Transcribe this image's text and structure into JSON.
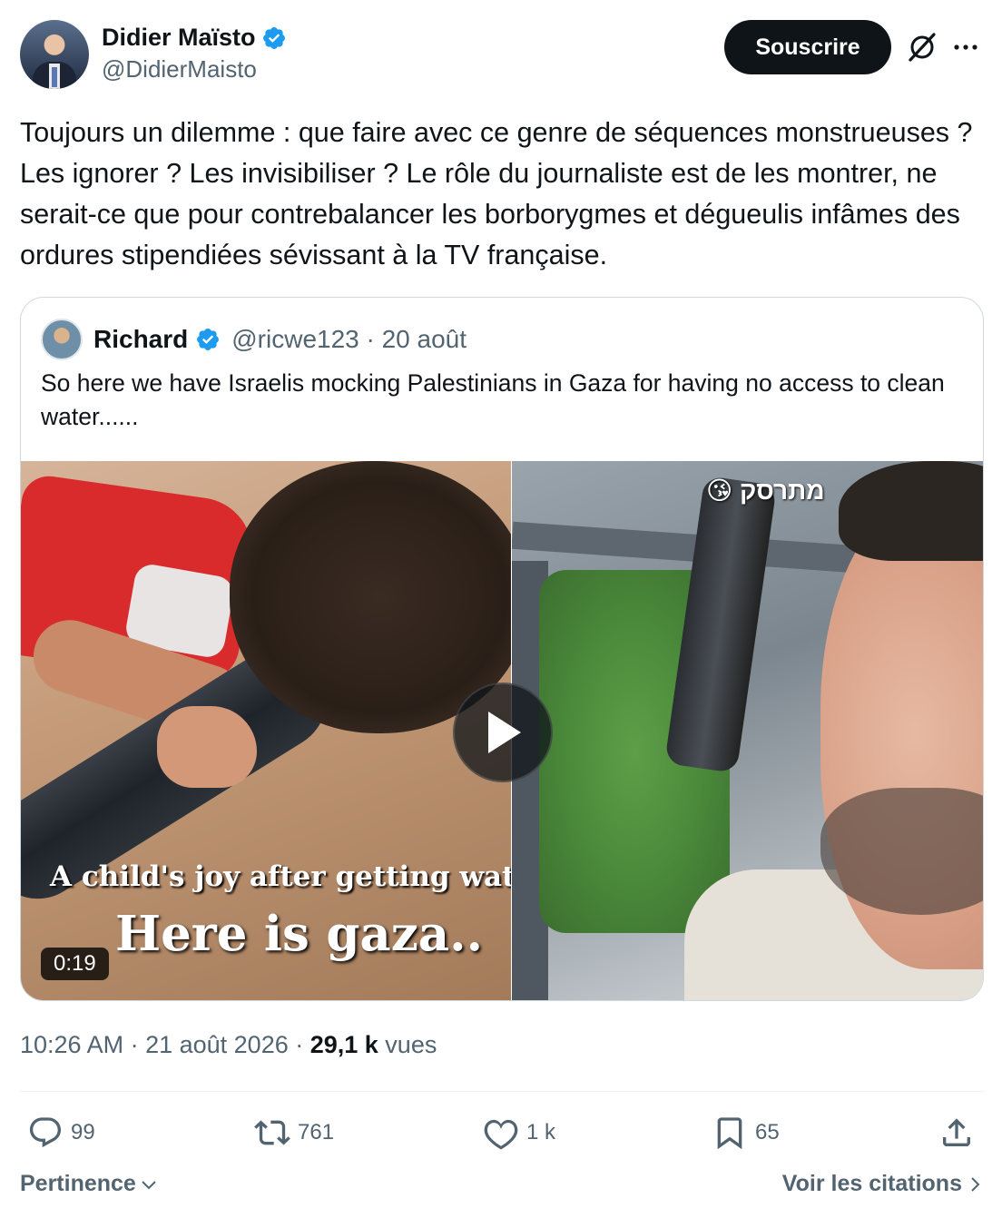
{
  "author": {
    "display_name": "Didier Maïsto",
    "handle": "@DidierMaisto",
    "verified": true
  },
  "header": {
    "subscribe_label": "Souscrire",
    "icons": [
      "grok-icon",
      "more-icon"
    ]
  },
  "tweet": {
    "text": "Toujours un dilemme : que faire avec ce genre de séquences monstrueuses ? Les ignorer ? Les invisibiliser ? Le rôle du journaliste est de les montrer, ne serait-ce que pour contrebalancer les borborygmes et dégueulis infâmes des ordures stipendiées sévissant à la TV française."
  },
  "quote": {
    "display_name": "Richard",
    "handle_date": "@ricwe123 · 20 août",
    "text": "So here we have Israelis mocking Palestinians in Gaza for having no access to clean water......",
    "media": {
      "caption_line1": "A child's joy after getting water",
      "caption_line2": "Here is gaza..",
      "overlay_label": "😘 מתרסק",
      "duration": "0:19"
    }
  },
  "meta": {
    "time_date": "10:26 AM · 21 août 2026 · ",
    "views_count": "29,1 k",
    "views_label": " vues"
  },
  "actions": {
    "replies": "99",
    "reposts": "761",
    "likes": "1 k",
    "bookmarks": "65"
  },
  "footer": {
    "sort_label": "Pertinence",
    "quotes_link": "Voir les citations"
  },
  "colors": {
    "verified_blue": "#1d9bf0",
    "text_primary": "#0f1419",
    "text_secondary": "#536471",
    "border": "#cfd9de"
  }
}
